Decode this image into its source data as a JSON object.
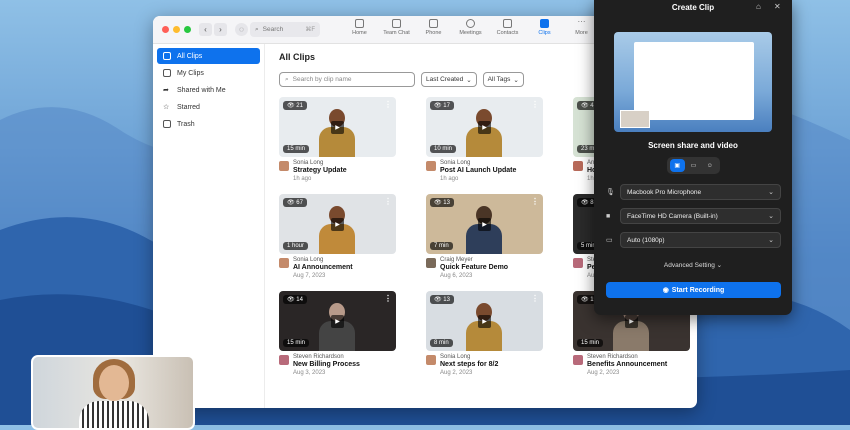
{
  "app": {
    "search_placeholder": "Search",
    "search_shortcut": "⌘F",
    "nav": [
      {
        "label": "Home",
        "icon": "home-icon"
      },
      {
        "label": "Team Chat",
        "icon": "chat-icon"
      },
      {
        "label": "Phone",
        "icon": "phone-icon"
      },
      {
        "label": "Meetings",
        "icon": "clock-icon"
      },
      {
        "label": "Contacts",
        "icon": "contacts-icon"
      },
      {
        "label": "Clips",
        "icon": "clips-icon"
      },
      {
        "label": "More",
        "icon": "more-icon"
      }
    ],
    "active_nav": "Clips",
    "accent": "#0e72ed"
  },
  "sidebar": {
    "items": [
      {
        "label": "All Clips",
        "icon": "clips-icon"
      },
      {
        "label": "My Clips",
        "icon": "user-clip-icon"
      },
      {
        "label": "Shared with Me",
        "icon": "share-icon"
      },
      {
        "label": "Starred",
        "icon": "star-icon"
      },
      {
        "label": "Trash",
        "icon": "trash-icon"
      }
    ]
  },
  "main": {
    "title": "All Clips",
    "search_placeholder": "Search by clip name",
    "sort_label": "Last Created",
    "tags_label": "All Tags",
    "clips": [
      {
        "views": "21",
        "duration": "15 min",
        "author": "Sonia Long",
        "title": "Strategy Update",
        "date": "1h ago"
      },
      {
        "views": "17",
        "duration": "10 min",
        "author": "Sonia Long",
        "title": "Post AI Launch Update",
        "date": "1h ago"
      },
      {
        "views": "43",
        "duration": "23 min",
        "author": "Anthony Rio",
        "title": "How to Ru",
        "date": "1h ago"
      },
      {
        "views": "67",
        "duration": "1 hour",
        "author": "Sonia Long",
        "title": "AI Announcement",
        "date": "Aug 7, 2023"
      },
      {
        "views": "13",
        "duration": "7 min",
        "author": "Craig Meyer",
        "title": "Quick Feature Demo",
        "date": "Aug 6, 2023"
      },
      {
        "views": "8",
        "duration": "5 min",
        "author": "Steven Rich",
        "title": "People Te",
        "date": "Aug 6, 2023"
      },
      {
        "views": "14",
        "duration": "15 min",
        "author": "Steven Richardson",
        "title": "New Billing Process",
        "date": "Aug 3, 2023"
      },
      {
        "views": "13",
        "duration": "8 min",
        "author": "Sonia Long",
        "title": "Next steps for 8/2",
        "date": "Aug 2, 2023"
      },
      {
        "views": "19",
        "duration": "15 min",
        "author": "Steven Richardson",
        "title": "Benefits Announcement",
        "date": "Aug 2, 2023"
      }
    ]
  },
  "panel": {
    "title": "Create Clip",
    "mode_label": "Screen share and video",
    "microphone": "Macbook Pro Microphone",
    "camera": "FaceTime HD Camera (Built-in)",
    "resolution": "Auto (1080p)",
    "advanced": "Advanced Setting",
    "record": "Start Recording"
  }
}
